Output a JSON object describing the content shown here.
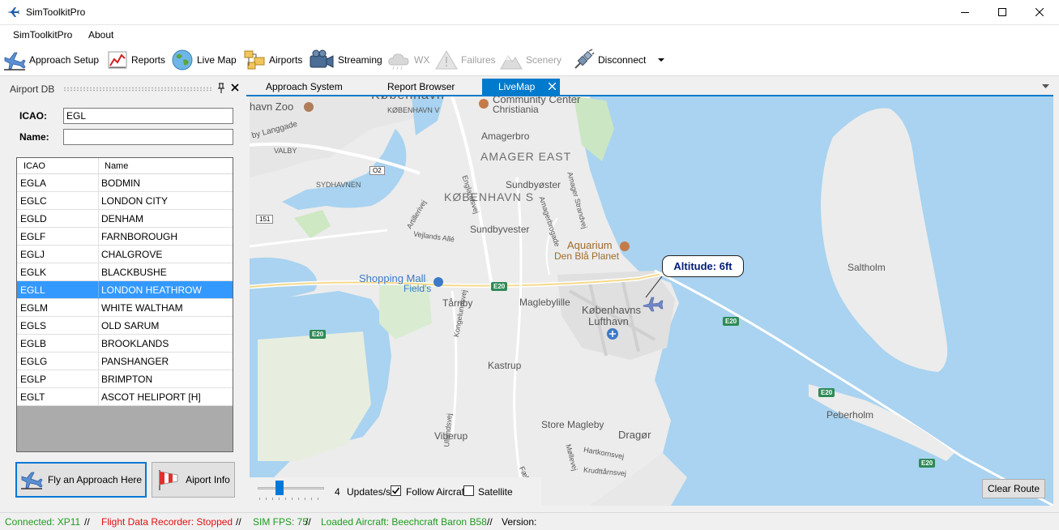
{
  "window": {
    "title": "SimToolkitPro"
  },
  "menu": [
    "SimToolkitPro",
    "About"
  ],
  "toolbar": [
    {
      "label": "Approach Setup",
      "icon": "plane-landing-icon",
      "enabled": true
    },
    {
      "label": "Reports",
      "icon": "chart-icon",
      "enabled": true
    },
    {
      "label": "Live Map",
      "icon": "globe-icon",
      "enabled": true
    },
    {
      "label": "Airports",
      "icon": "folders-icon",
      "enabled": true
    },
    {
      "label": "Streaming",
      "icon": "camera-icon",
      "enabled": true
    },
    {
      "label": "WX",
      "icon": "cloud-icon",
      "enabled": false
    },
    {
      "label": "Failures",
      "icon": "warning-icon",
      "enabled": false
    },
    {
      "label": "Scenery",
      "icon": "mountain-icon",
      "enabled": false
    },
    {
      "label": "Disconnect",
      "icon": "plug-icon",
      "enabled": true
    }
  ],
  "airport_db": {
    "title": "Airport DB",
    "icao_label": "ICAO:",
    "icao_value": "EGL",
    "name_label": "Name:",
    "name_value": "",
    "columns": [
      "ICAO",
      "Name"
    ],
    "rows": [
      [
        "EGLA",
        "BODMIN"
      ],
      [
        "EGLC",
        "LONDON CITY"
      ],
      [
        "EGLD",
        "DENHAM"
      ],
      [
        "EGLF",
        "FARNBOROUGH"
      ],
      [
        "EGLJ",
        "CHALGROVE"
      ],
      [
        "EGLK",
        "BLACKBUSHE"
      ],
      [
        "EGLL",
        "LONDON HEATHROW"
      ],
      [
        "EGLM",
        "WHITE WALTHAM"
      ],
      [
        "EGLS",
        "OLD SARUM"
      ],
      [
        "EGLB",
        "BROOKLANDS"
      ],
      [
        "EGLG",
        "PANSHANGER"
      ],
      [
        "EGLP",
        "BRIMPTON"
      ],
      [
        "EGLT",
        "ASCOT HELIPORT [H]"
      ]
    ],
    "selected_row": 6,
    "fly_button": "Fly an Approach Here",
    "info_button": "Aiport Info"
  },
  "tabs": [
    {
      "label": "Approach System",
      "active": false
    },
    {
      "label": "Report Browser",
      "active": false
    },
    {
      "label": "LiveMap",
      "active": true
    }
  ],
  "map": {
    "altitude_callout": "Altitude: 6ft",
    "labels": {
      "zoo": "havn Zoo",
      "copenhagen": "København",
      "community_center": "Community Center",
      "christiania": "Christiania",
      "langgade": "by Langgade",
      "valby": "VALBY",
      "amagerbro": "Amagerbro",
      "amager_east": "AMAGER EAST",
      "kobenhavn_v": "KØBENHAVN V",
      "o2": "O2",
      "sydhavnen": "SYDHAVNEN",
      "kobenhavn_s": "KØBENHAVN S",
      "sundbyoster": "Sundbyøster",
      "amager_strandvej": "Amager Strandvej",
      "artillerivej": "Artillerivej",
      "r151": "151",
      "vejlands_alle": "Vejlands Allé",
      "englandsvej": "Englandsvej",
      "sundbyvester": "Sundbyvester",
      "amagerbrogade": "Amagerbrogade",
      "aquarium": "Aquarium",
      "den_bla_planet": "Den Blå Planet",
      "saltholm": "Saltholm",
      "shopping_mall": "Shopping Mall",
      "fields": "Field's",
      "e20": "E20",
      "tarnby": "Tårnby",
      "maglebylille": "Maglebylille",
      "airport_1": "Københavns",
      "airport_2": "Lufthavn",
      "kongelundsvej": "Kongelundsvej",
      "kastrup": "Kastrup",
      "peberholm": "Peberholm",
      "store_magleby": "Store Magleby",
      "viberup": "Viberup",
      "dragor": "Dragør",
      "hartkornsvej": "Hartkornsvej",
      "molleve": "Møllevej",
      "krudttarnsvej": "Krudttårnsvej",
      "faelledvej": "Fælledvej",
      "ullandsvej": "Ullandsvej",
      "e20_a": "E20",
      "e20_b": "E20",
      "e20_c": "E20",
      "e20_d": "E20",
      "e20_e": "E20"
    },
    "update_rate": "4",
    "update_unit": "Updates/s",
    "update_slider_fraction": 0.3,
    "follow_aircraft": {
      "label": "Follow Aircraft",
      "checked": true
    },
    "satellite": {
      "label": "Satellite",
      "checked": false
    },
    "clear_route": "Clear Route"
  },
  "status": {
    "connected": "Connected: XP11",
    "sep": "//",
    "recorder": "Flight Data Recorder: Stopped",
    "fps": "SIM FPS: 75",
    "aircraft": "Loaded Aircraft: Beechcraft Baron B58",
    "version": "Version:"
  },
  "colors": {
    "accent": "#007acc",
    "selection": "#3399ff",
    "status_ok": "#1f9b1f",
    "status_bad": "#e01010",
    "water": "#a9d3f0",
    "land": "#ececec"
  }
}
